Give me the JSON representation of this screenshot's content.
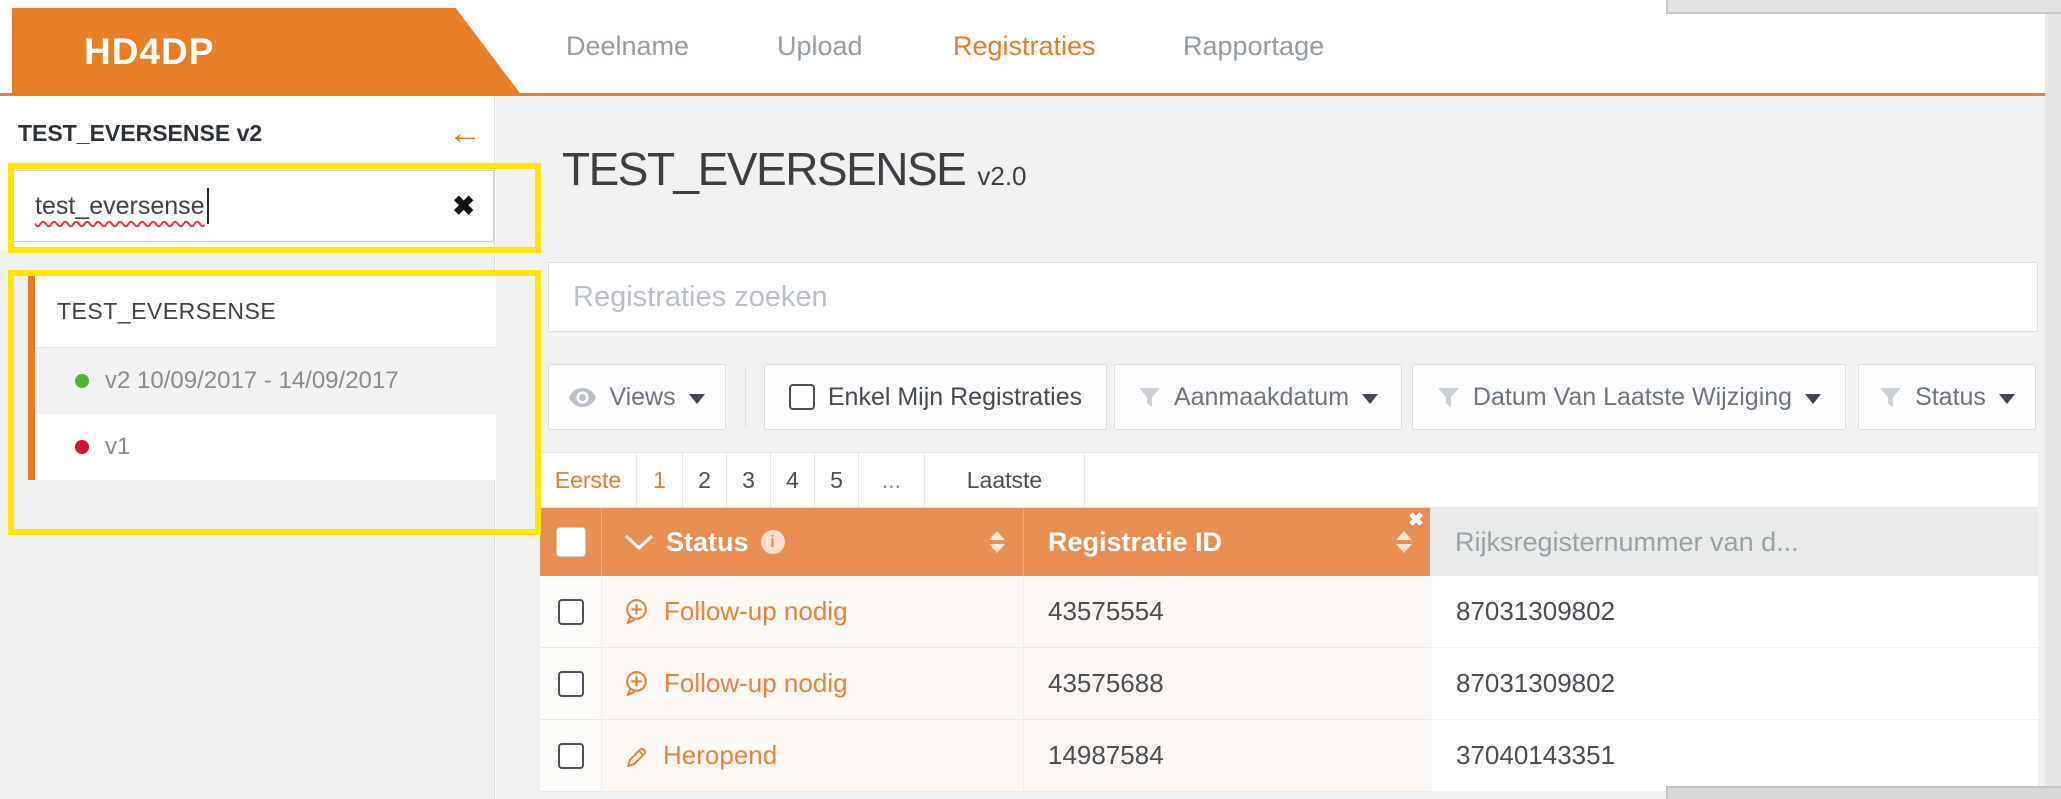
{
  "app": {
    "brand": "HD4DP"
  },
  "nav": {
    "items": [
      {
        "label": "Deelname"
      },
      {
        "label": "Upload"
      },
      {
        "label": "Registraties"
      },
      {
        "label": "Rapportage"
      }
    ],
    "active": "Registraties"
  },
  "sidebar": {
    "title": "TEST_EVERSENSE v2",
    "back_icon": "←",
    "search": {
      "value": "test_eversense",
      "clear_icon": "✖"
    },
    "results": {
      "group_title": "TEST_EVERSENSE",
      "versions": [
        {
          "label": "v2 10/09/2017 - 14/09/2017",
          "dot_color": "#55b22c"
        },
        {
          "label": "v1",
          "dot_color": "#d2122f"
        }
      ]
    }
  },
  "main": {
    "title": "TEST_EVERSENSE",
    "version": "v2.0",
    "search_placeholder": "Registraties zoeken",
    "filters": {
      "views_label": "Views",
      "only_mine_label": "Enkel Mijn Registraties",
      "only_mine_checked": false,
      "dropdowns": [
        {
          "label": "Aanmaakdatum"
        },
        {
          "label": "Datum Van Laatste Wijziging"
        },
        {
          "label": "Status"
        }
      ]
    },
    "pagination": {
      "items": [
        {
          "label": "Eerste",
          "active": true
        },
        {
          "label": "1",
          "active": true
        },
        {
          "label": "2"
        },
        {
          "label": "3"
        },
        {
          "label": "4"
        },
        {
          "label": "5"
        },
        {
          "label": "..."
        },
        {
          "label": "Laatste"
        }
      ]
    },
    "table": {
      "remove_column_icon": "✖",
      "columns": [
        {
          "label": "Status",
          "has_info": true,
          "sortable": true
        },
        {
          "label": "Registratie ID",
          "sortable": true
        },
        {
          "label": "Rijksregisternummer van d..."
        }
      ],
      "rows": [
        {
          "status": "Follow-up nodig",
          "status_icon": "comment-plus-icon",
          "registratie_id": "43575554",
          "rijksregisternummer": "87031309802"
        },
        {
          "status": "Follow-up nodig",
          "status_icon": "comment-plus-icon",
          "registratie_id": "43575688",
          "rijksregisternummer": "87031309802"
        },
        {
          "status": "Heropend",
          "status_icon": "pencil-icon",
          "registratie_id": "14987584",
          "rijksregisternummer": "37040143351"
        }
      ]
    }
  },
  "colors": {
    "brand_orange": "#e87e26",
    "table_header_orange": "#e98e52",
    "status_orange": "#e8823c",
    "highlight_yellow": "#ffe501",
    "version_active_green": "#55b22c",
    "version_inactive_red": "#d2122f"
  }
}
